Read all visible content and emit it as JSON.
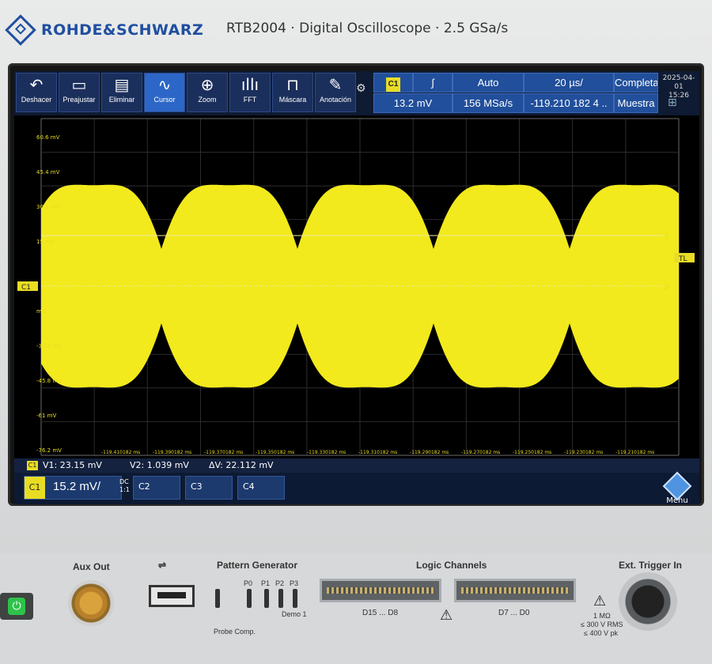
{
  "header": {
    "brand": "ROHDE&SCHWARZ",
    "model": "RTB2004 · Digital Oscilloscope · 2.5 GSa/s"
  },
  "toolbar": [
    {
      "label": "Deshacer",
      "icon": "undo-icon",
      "glyph": "↶",
      "active": false
    },
    {
      "label": "Preajustar",
      "icon": "preset-icon",
      "glyph": "▭",
      "active": false
    },
    {
      "label": "Eliminar",
      "icon": "trash-icon",
      "glyph": "🗑",
      "active": false
    },
    {
      "label": "Cursor",
      "icon": "wave-icon",
      "glyph": "∿",
      "active": true
    },
    {
      "label": "Zoom",
      "icon": "zoom-icon",
      "glyph": "⊕",
      "active": false
    },
    {
      "label": "FFT",
      "icon": "fft-icon",
      "glyph": "ıllı",
      "active": false
    },
    {
      "label": "Máscara",
      "icon": "mask-icon",
      "glyph": "⊓",
      "active": false
    },
    {
      "label": "Anotación",
      "icon": "pencil-icon",
      "glyph": "✎",
      "active": false
    }
  ],
  "status": {
    "trigger_source": "C1",
    "trigger_slope": "∫",
    "trigger_level": "13.2 mV",
    "mode": "Auto",
    "samplerate": "156 MSa/s",
    "timebase": "20 µs/",
    "position": "-119.210 182 4 ..",
    "acq_state": "Completa",
    "acq_mode": "Muestra",
    "date": "2025-04-01",
    "time": "15:26"
  },
  "plot": {
    "y_labels": [
      "60.6 mV",
      "45.4 mV",
      "30.2 mV",
      "15 mV",
      "",
      "mV",
      "-30.6 mV",
      "-45.8 mV",
      "-61 mV",
      "-76.2 mV"
    ],
    "x_labels": [
      "-119.410182 ms",
      "-119.390182 ms",
      "-119.370182 ms",
      "-119.350182 ms",
      "-119.330182 ms",
      "-119.310182 ms",
      "-119.290182 ms",
      "-119.270182 ms",
      "-119.250182 ms",
      "-119.230182 ms",
      "-119.210182 ms"
    ],
    "channel_marker": "C1",
    "trigger_marker": "TL",
    "cursor1_label": "1",
    "cursor2_label": "2",
    "trace_color": "#f2ea1c"
  },
  "cursors": {
    "tag": "C1",
    "v1": "V1: 23.15 mV",
    "v2": "V2: 1.039 mV",
    "dv": "ΔV: 22.112 mV"
  },
  "channels": {
    "c1_label": "C1",
    "c1_scale": "15.2 mV/",
    "c1_coupling": "DC",
    "c1_probe": "1:1",
    "others": [
      "C2",
      "C3",
      "C4"
    ],
    "menu": "Menu"
  },
  "front": {
    "aux_out": "Aux Out",
    "pattern_generator": "Pattern Generator",
    "pins": [
      "P0",
      "P1",
      "P2",
      "P3"
    ],
    "demo": "Demo 1",
    "probe_comp": "Probe Comp.",
    "logic_channels": "Logic Channels",
    "d_hi": "D15 ... D8",
    "d_lo": "D7 ... D0",
    "ext_trigger": "Ext. Trigger In",
    "ext_spec1": "1 MΩ",
    "ext_spec2": "≤ 300 V RMS",
    "ext_spec3": "≤ 400 V pk"
  }
}
